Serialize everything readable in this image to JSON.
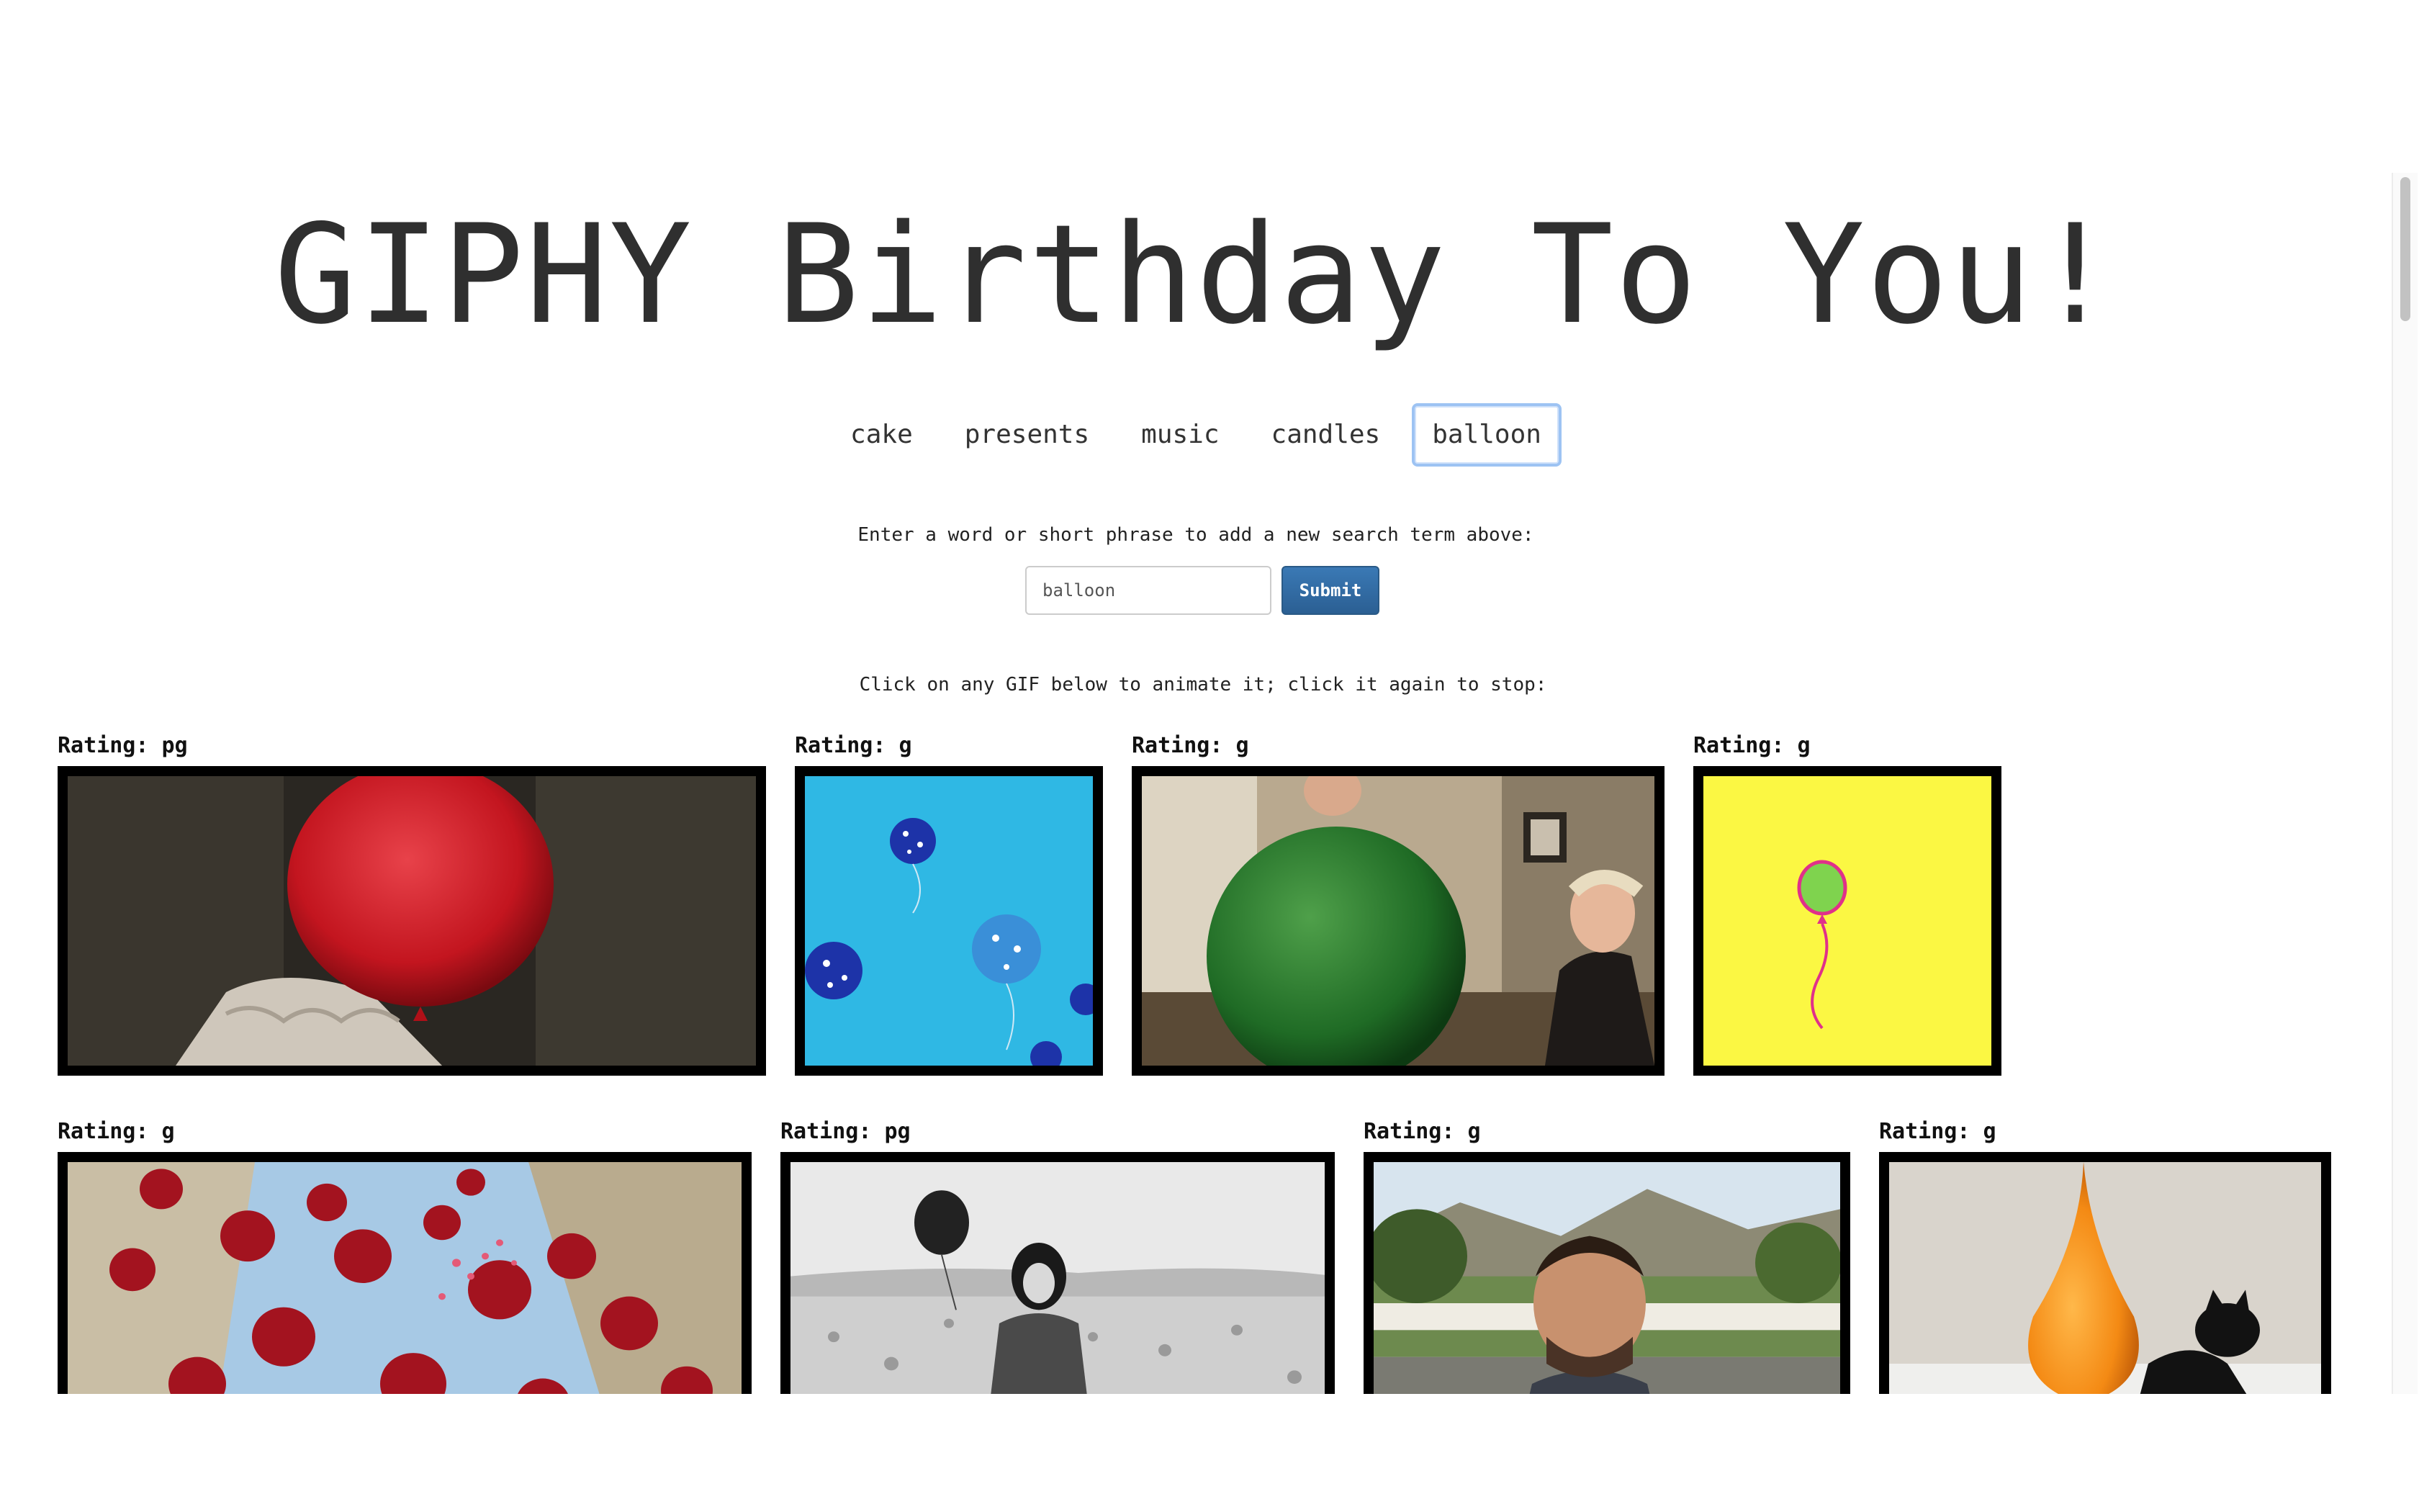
{
  "title": "GIPHY Birthday To You!",
  "topics": [
    "cake",
    "presents",
    "music",
    "candles",
    "balloon"
  ],
  "active_topic": "balloon",
  "search": {
    "instruction": "Enter a word or short phrase to add a new search term above:",
    "value": "balloon",
    "submit_label": "Submit"
  },
  "gif_instruction": "Click on any GIF below to animate it; click it again to stop:",
  "gifs": [
    {
      "rating": "Rating: pg",
      "subject": "red balloon clown"
    },
    {
      "rating": "Rating: g",
      "subject": "blue balloons sky"
    },
    {
      "rating": "Rating: g",
      "subject": "green balloon man"
    },
    {
      "rating": "Rating: g",
      "subject": "green balloon yellow background"
    },
    {
      "rating": "Rating: g",
      "subject": "red balloons rising"
    },
    {
      "rating": "Rating: pg",
      "subject": "black balloon desert"
    },
    {
      "rating": "Rating: g",
      "subject": "man squinting"
    },
    {
      "rating": "Rating: g",
      "subject": "orange balloon cat"
    }
  ],
  "colors": {
    "active_border": "#9dc3f3",
    "submit_bg": "#2b5f93",
    "frame": "#000000"
  }
}
